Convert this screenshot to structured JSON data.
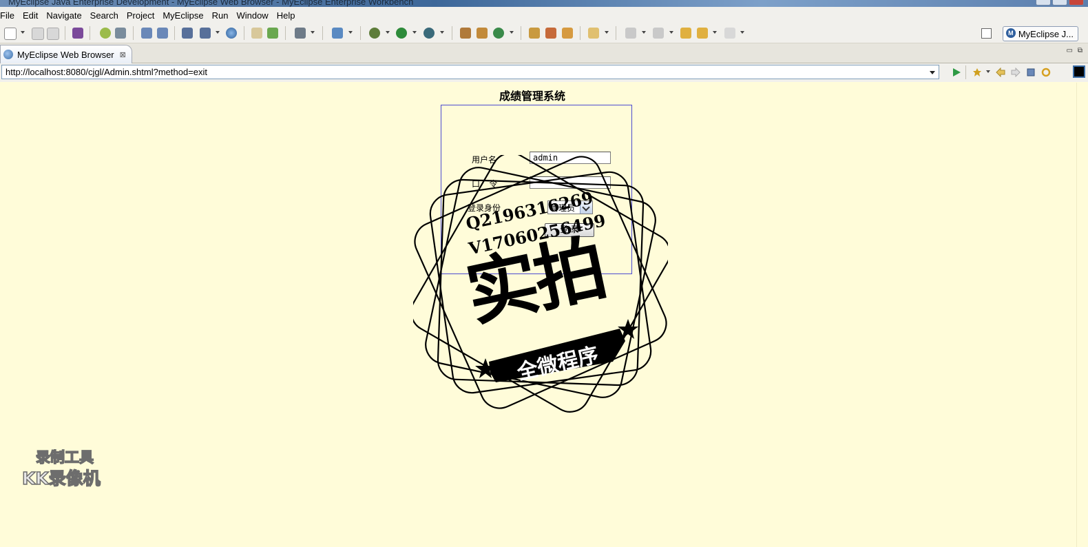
{
  "window": {
    "title": "MyEclipse Java Enterprise Development - MyEclipse Web Browser - MyEclipse Enterprise Workbench"
  },
  "menu": [
    "File",
    "Edit",
    "Navigate",
    "Search",
    "Project",
    "MyEclipse",
    "Run",
    "Window",
    "Help"
  ],
  "toolbar": {
    "perspective_label": "MyEclipse J...",
    "perspective_icon_letter": "M"
  },
  "tab": {
    "label": "MyEclipse Web Browser",
    "close_glyph": "⊠"
  },
  "browser": {
    "url": "http://localhost:8080/cjgl/Admin.shtml?method=exit"
  },
  "page": {
    "title": "成绩管理系统",
    "username_label": "用户名",
    "username_value": "admin",
    "password_label": "口    令",
    "role_label": "登录身份",
    "role_selected": "管理员",
    "submit_label": "登 录"
  },
  "overlay": {
    "qq_line": "Q2196316269",
    "wechat_line": "V17060256499",
    "stamp_main": "实拍",
    "stamp_banner": "全微程序"
  },
  "recorder_watermark": {
    "line1": "录制工具",
    "line2": "KK录像机"
  },
  "colors": {
    "page_background": "#fffcd9",
    "form_border": "#4b4bcf",
    "ide_chrome": "#f1f0ec"
  }
}
